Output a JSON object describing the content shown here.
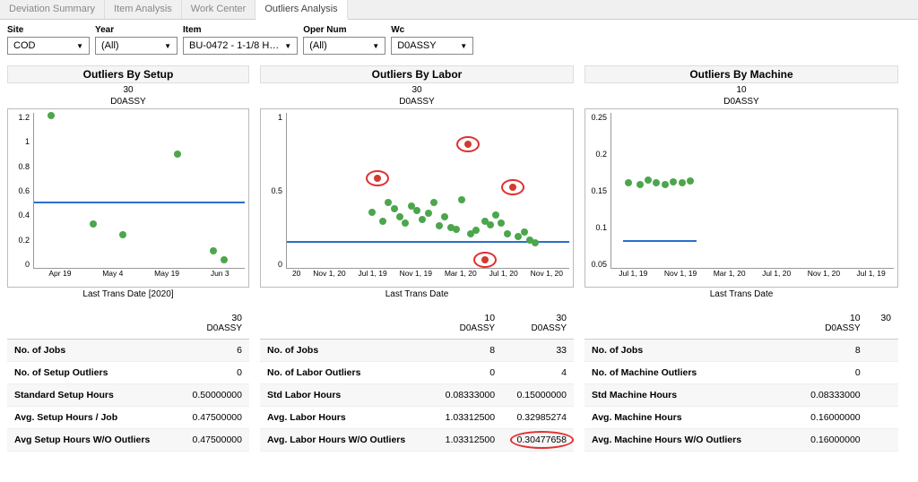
{
  "tabs": [
    "Deviation Summary",
    "Item Analysis",
    "Work Center",
    "Outliers Analysis"
  ],
  "active_tab": "Outliers Analysis",
  "filters": {
    "site": {
      "label": "Site",
      "value": "COD"
    },
    "year": {
      "label": "Year",
      "value": "(All)"
    },
    "item": {
      "label": "Item",
      "value": "BU-0472 - 1-1/8 H…"
    },
    "opernum": {
      "label": "Oper Num",
      "value": "(All)"
    },
    "wc": {
      "label": "Wc",
      "value": "D0ASSY"
    }
  },
  "chart_data": [
    {
      "id": "setup",
      "type": "scatter",
      "title": "Outliers By Setup",
      "header_top": "30",
      "header_bot": "D0ASSY",
      "xlabel": "Last Trans Date [2020]",
      "ylabel": "",
      "y_ticks": [
        0.0,
        0.2,
        0.4,
        0.6,
        0.8,
        1.0,
        1.2
      ],
      "x_ticks": [
        "Apr 19",
        "May 4",
        "May 19",
        "Jun 3"
      ],
      "ref_line": 0.5,
      "points": [
        {
          "x": "Apr 10",
          "xi": 0.08,
          "y": 1.18,
          "kind": "g"
        },
        {
          "x": "Apr 25",
          "xi": 0.28,
          "y": 0.34,
          "kind": "g"
        },
        {
          "x": "May 6",
          "xi": 0.42,
          "y": 0.26,
          "kind": "g"
        },
        {
          "x": "May 25",
          "xi": 0.68,
          "y": 0.88,
          "kind": "g"
        },
        {
          "x": "Jun 4",
          "xi": 0.85,
          "y": 0.13,
          "kind": "g"
        },
        {
          "x": "Jun 6",
          "xi": 0.9,
          "y": 0.06,
          "kind": "g"
        }
      ]
    },
    {
      "id": "labor",
      "type": "scatter",
      "title": "Outliers By Labor",
      "header_top": "30",
      "header_bot": "D0ASSY",
      "xlabel": "Last Trans Date",
      "ylabel": "",
      "y_ticks": [
        0.0,
        0.5,
        1.0
      ],
      "x_ticks": [
        "20",
        "Nov 1, 20",
        "Jul 1, 19",
        "Nov 1, 19",
        "Mar 1, 20",
        "Jul 1, 20",
        "Nov 1, 20"
      ],
      "ref_line": 0.16,
      "points": [
        {
          "xi": 0.32,
          "y": 0.58,
          "kind": "r",
          "circle": true
        },
        {
          "xi": 0.64,
          "y": 0.8,
          "kind": "r",
          "circle": true
        },
        {
          "xi": 0.8,
          "y": 0.52,
          "kind": "r",
          "circle": true
        },
        {
          "xi": 0.7,
          "y": 0.05,
          "kind": "r",
          "circle": true
        },
        {
          "xi": 0.3,
          "y": 0.36,
          "kind": "g"
        },
        {
          "xi": 0.34,
          "y": 0.3,
          "kind": "g"
        },
        {
          "xi": 0.36,
          "y": 0.42,
          "kind": "g"
        },
        {
          "xi": 0.38,
          "y": 0.38,
          "kind": "g"
        },
        {
          "xi": 0.4,
          "y": 0.33,
          "kind": "g"
        },
        {
          "xi": 0.42,
          "y": 0.29,
          "kind": "g"
        },
        {
          "xi": 0.44,
          "y": 0.4,
          "kind": "g"
        },
        {
          "xi": 0.46,
          "y": 0.37,
          "kind": "g"
        },
        {
          "xi": 0.48,
          "y": 0.31,
          "kind": "g"
        },
        {
          "xi": 0.5,
          "y": 0.35,
          "kind": "g"
        },
        {
          "xi": 0.52,
          "y": 0.42,
          "kind": "g"
        },
        {
          "xi": 0.54,
          "y": 0.27,
          "kind": "g"
        },
        {
          "xi": 0.56,
          "y": 0.33,
          "kind": "g"
        },
        {
          "xi": 0.58,
          "y": 0.26,
          "kind": "g"
        },
        {
          "xi": 0.6,
          "y": 0.25,
          "kind": "g"
        },
        {
          "xi": 0.62,
          "y": 0.44,
          "kind": "g"
        },
        {
          "xi": 0.65,
          "y": 0.22,
          "kind": "g"
        },
        {
          "xi": 0.67,
          "y": 0.24,
          "kind": "g"
        },
        {
          "xi": 0.7,
          "y": 0.3,
          "kind": "g"
        },
        {
          "xi": 0.72,
          "y": 0.28,
          "kind": "g"
        },
        {
          "xi": 0.74,
          "y": 0.34,
          "kind": "g"
        },
        {
          "xi": 0.76,
          "y": 0.29,
          "kind": "g"
        },
        {
          "xi": 0.78,
          "y": 0.22,
          "kind": "g"
        },
        {
          "xi": 0.82,
          "y": 0.2,
          "kind": "g"
        },
        {
          "xi": 0.84,
          "y": 0.23,
          "kind": "g"
        },
        {
          "xi": 0.86,
          "y": 0.18,
          "kind": "g"
        },
        {
          "xi": 0.88,
          "y": 0.16,
          "kind": "g"
        }
      ]
    },
    {
      "id": "machine",
      "type": "scatter",
      "title": "Outliers By Machine",
      "header_top": "10",
      "header_bot": "D0ASSY",
      "xlabel": "Last Trans Date",
      "ylabel": "",
      "y_ticks": [
        0.05,
        0.1,
        0.15,
        0.2,
        0.25
      ],
      "x_ticks": [
        "Jul 1, 19",
        "Nov 1, 19",
        "Mar 1, 20",
        "Jul 1, 20",
        "Nov 1, 20",
        "Jul 1, 19"
      ],
      "ref_line": 0.083,
      "points": [
        {
          "xi": 0.06,
          "y": 0.16,
          "kind": "g"
        },
        {
          "xi": 0.1,
          "y": 0.157,
          "kind": "g"
        },
        {
          "xi": 0.13,
          "y": 0.163,
          "kind": "g"
        },
        {
          "xi": 0.16,
          "y": 0.16,
          "kind": "g"
        },
        {
          "xi": 0.19,
          "y": 0.158,
          "kind": "g"
        },
        {
          "xi": 0.22,
          "y": 0.161,
          "kind": "g"
        },
        {
          "xi": 0.25,
          "y": 0.16,
          "kind": "g"
        },
        {
          "xi": 0.28,
          "y": 0.162,
          "kind": "g"
        }
      ],
      "ref_line_extent": [
        0.04,
        0.3
      ]
    }
  ],
  "tables": {
    "setup": {
      "cols": [
        "",
        "30"
      ],
      "sub": [
        "",
        "D0ASSY"
      ],
      "rows": [
        [
          "No. of Jobs",
          "6"
        ],
        [
          "No. of Setup Outliers",
          "0"
        ],
        [
          "Standard Setup Hours",
          "0.50000000"
        ],
        [
          "Avg. Setup Hours / Job",
          "0.47500000"
        ],
        [
          "Avg Setup Hours W/O Outliers",
          "0.47500000"
        ]
      ]
    },
    "labor": {
      "cols": [
        "",
        "10",
        "30"
      ],
      "sub": [
        "",
        "D0ASSY",
        "D0ASSY"
      ],
      "rows": [
        [
          "No. of Jobs",
          "8",
          "33"
        ],
        [
          "No. of Labor Outliers",
          "0",
          "4"
        ],
        [
          "Std Labor Hours",
          "0.08333000",
          "0.15000000"
        ],
        [
          "Avg. Labor Hours",
          "1.03312500",
          "0.32985274"
        ],
        [
          "Avg. Labor Hours W/O Outliers",
          "1.03312500",
          "0.30477658"
        ]
      ],
      "circled": {
        "row": 4,
        "col": 2
      }
    },
    "machine": {
      "cols": [
        "",
        "10",
        "30"
      ],
      "sub": [
        "",
        "D0ASSY",
        ""
      ],
      "rows": [
        [
          "No. of Jobs",
          "8",
          ""
        ],
        [
          "No. of Machine Outliers",
          "0",
          ""
        ],
        [
          "Std Machine Hours",
          "0.08333000",
          ""
        ],
        [
          "Avg. Machine Hours",
          "0.16000000",
          ""
        ],
        [
          "Avg. Machine Hours W/O Outliers",
          "0.16000000",
          ""
        ]
      ]
    }
  }
}
